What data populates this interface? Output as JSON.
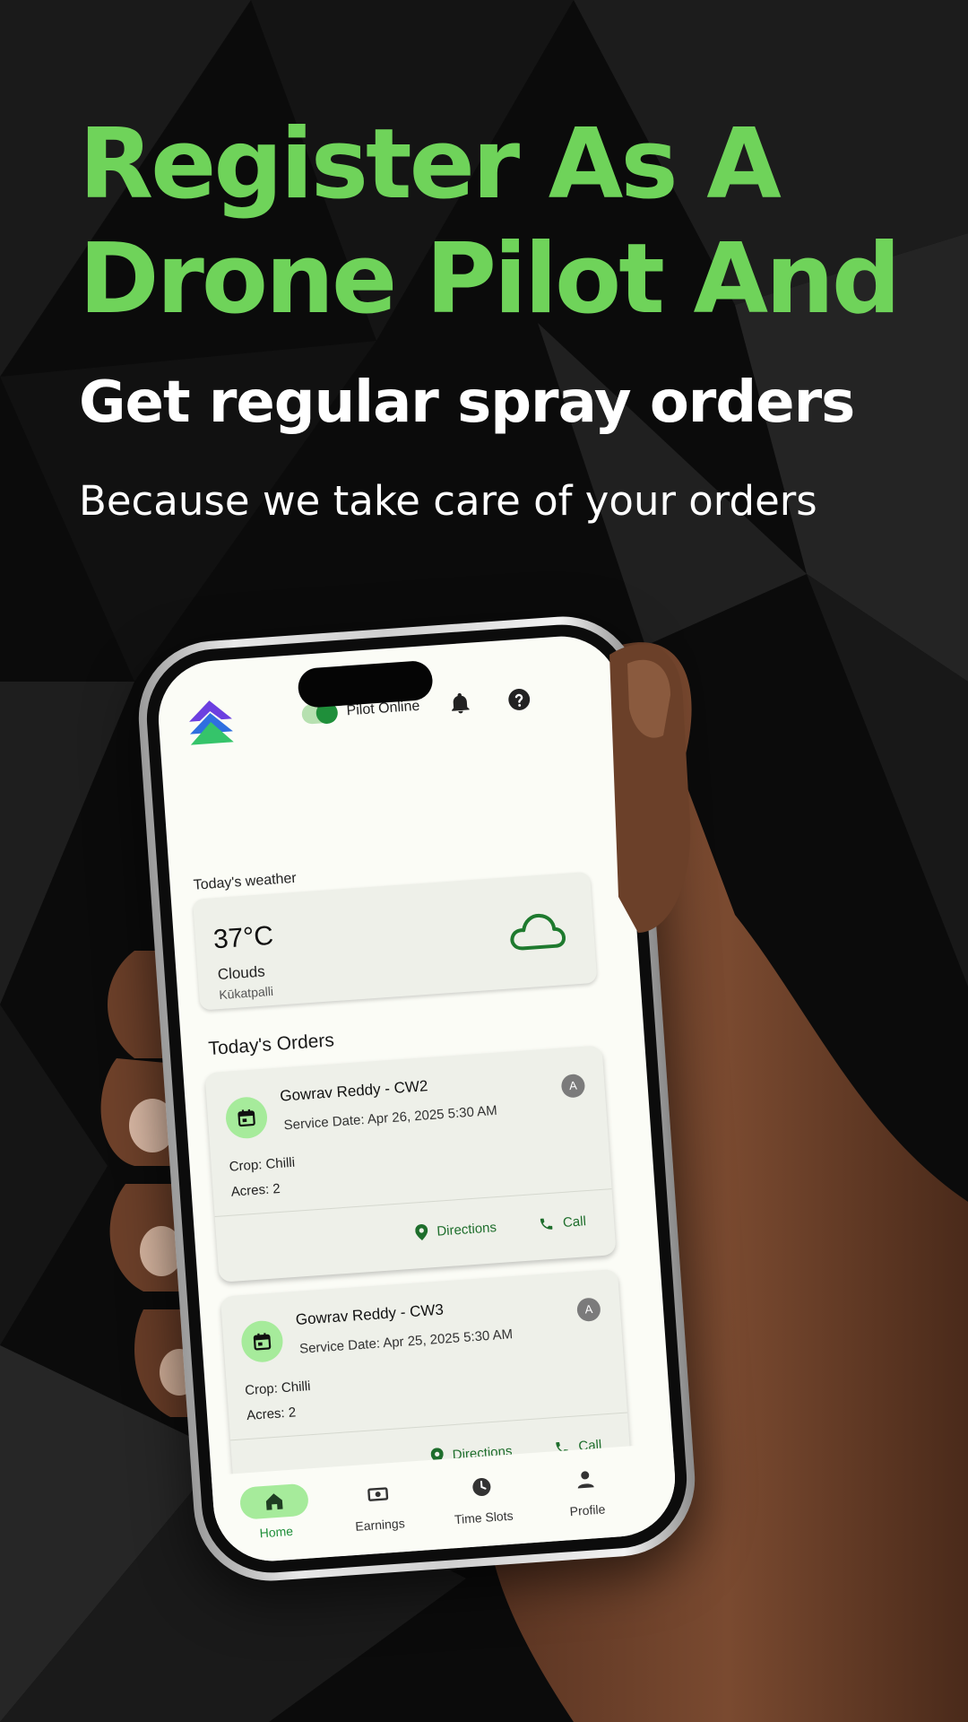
{
  "promo": {
    "headline_line1": "Register As A",
    "headline_line2": "Drone Pilot And",
    "subhead": "Get regular spray orders",
    "tagline": "Because we take care of your orders"
  },
  "app": {
    "header": {
      "status_label": "Pilot Online",
      "status_on": true,
      "icons": [
        "app-logo",
        "bell-icon",
        "help-icon"
      ]
    },
    "weather": {
      "section_title": "Today's weather",
      "temperature": "37°C",
      "condition": "Clouds",
      "location": "Kūkatpalli",
      "icon": "cloud-icon"
    },
    "orders": {
      "section_title": "Today's Orders",
      "items": [
        {
          "name": "Gowrav Reddy - CW2",
          "service_date": "Service Date: Apr 26, 2025 5:30 AM",
          "avatar": "A",
          "crop": "Crop: Chilli",
          "acres": "Acres: 2",
          "directions_label": "Directions",
          "call_label": "Call"
        },
        {
          "name": "Gowrav Reddy - CW3",
          "service_date": "Service Date: Apr 25, 2025 5:30 AM",
          "avatar": "A",
          "crop": "Crop: Chilli",
          "acres": "Acres: 2",
          "directions_label": "Directions",
          "call_label": "Call"
        }
      ]
    },
    "bottom_nav": [
      {
        "label": "Home",
        "icon": "home-icon",
        "active": true
      },
      {
        "label": "Earnings",
        "icon": "cash-icon",
        "active": false
      },
      {
        "label": "Time Slots",
        "icon": "clock-icon",
        "active": false
      },
      {
        "label": "Profile",
        "icon": "person-icon",
        "active": false
      }
    ]
  },
  "colors": {
    "accent_green": "#6fd35a",
    "app_green": "#1f8f3a",
    "pill_green": "#a6eb9b",
    "background": "#0a0a0a"
  }
}
